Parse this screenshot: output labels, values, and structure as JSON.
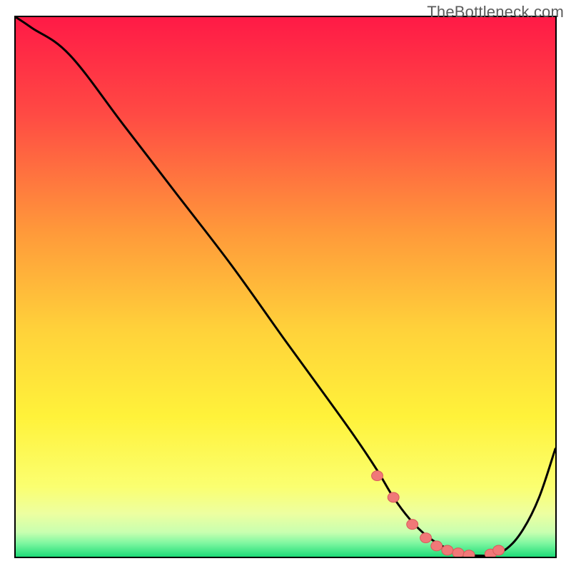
{
  "watermark": "TheBottleneck.com",
  "colors": {
    "border": "#000000",
    "gradient_top": "#ff1a46",
    "gradient_mid_orange": "#ff8a3b",
    "gradient_mid_yellow": "#ffe43a",
    "gradient_light_yellow": "#fffb8a",
    "gradient_pale": "#e6ffb3",
    "gradient_green": "#1ee67a",
    "curve": "#000000",
    "dot_fill": "#f07878",
    "dot_stroke": "#d85a5a"
  },
  "chart_data": {
    "type": "line",
    "title": "",
    "xlabel": "",
    "ylabel": "",
    "xlim": [
      0,
      100
    ],
    "ylim": [
      0,
      100
    ],
    "series": [
      {
        "name": "bottleneck-curve",
        "x": [
          0,
          3,
          10,
          20,
          30,
          40,
          50,
          58,
          63,
          67,
          70,
          73,
          76,
          79,
          82,
          84,
          86,
          88,
          91,
          94,
          97,
          100
        ],
        "y": [
          100,
          98,
          93,
          80,
          67,
          54,
          40,
          29,
          22,
          16,
          11,
          7,
          4,
          2,
          0.7,
          0.3,
          0.2,
          0.3,
          1.5,
          5,
          11,
          20
        ]
      }
    ],
    "dots": {
      "name": "bottleneck-markers",
      "x": [
        67,
        70,
        73.5,
        76,
        78,
        80,
        82,
        84,
        88,
        89.5
      ],
      "y": [
        15,
        11,
        6,
        3.5,
        2,
        1.2,
        0.7,
        0.3,
        0.5,
        1.2
      ]
    }
  }
}
